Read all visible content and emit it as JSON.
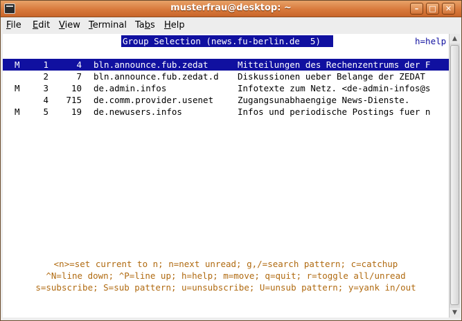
{
  "window": {
    "title": "musterfrau@desktop: ~",
    "buttons": {
      "minimize": "–",
      "maximize": "□",
      "close": "✕"
    }
  },
  "menu": [
    {
      "underline": "F",
      "rest": "ile"
    },
    {
      "underline": "E",
      "rest": "dit"
    },
    {
      "underline": "V",
      "rest": "iew"
    },
    {
      "underline": "T",
      "rest": "erminal"
    },
    {
      "prefix": "Ta",
      "underline": "b",
      "rest": "s"
    },
    {
      "underline": "H",
      "rest": "elp"
    }
  ],
  "terminal": {
    "header": "Group Selection (news.fu-berlin.de  5)",
    "help_hint": "h=help",
    "groups": [
      {
        "mark": "M",
        "index": "1",
        "count": "4",
        "name": "bln.announce.fub.zedat",
        "description": "Mitteilungen des Rechenzentrums der F",
        "selected": true
      },
      {
        "mark": "",
        "index": "2",
        "count": "7",
        "name": "bln.announce.fub.zedat.d",
        "description": "Diskussionen ueber Belange der ZEDAT",
        "selected": false
      },
      {
        "mark": "M",
        "index": "3",
        "count": "10",
        "name": "de.admin.infos",
        "description": "Infotexte zum Netz. <de-admin-infos@s",
        "selected": false
      },
      {
        "mark": "",
        "index": "4",
        "count": "715",
        "name": "de.comm.provider.usenet",
        "description": "Zugangsunabhaengige News-Dienste.",
        "selected": false
      },
      {
        "mark": "M",
        "index": "5",
        "count": "19",
        "name": "de.newusers.infos",
        "description": "Infos und periodische Postings fuer n",
        "selected": false
      }
    ],
    "footer": [
      "<n>=set current to n; n=next unread; g,/=search pattern; c=catchup",
      "^N=line down; ^P=line up; h=help; m=move; q=quit; r=toggle all/unread",
      "s=subscribe; S=sub pattern; u=unsubscribe; U=unsub pattern; y=yank in/out"
    ]
  },
  "colors": {
    "selection": "#1010a0",
    "footer_text": "#b06a10",
    "titlebar": "#d8793c"
  }
}
